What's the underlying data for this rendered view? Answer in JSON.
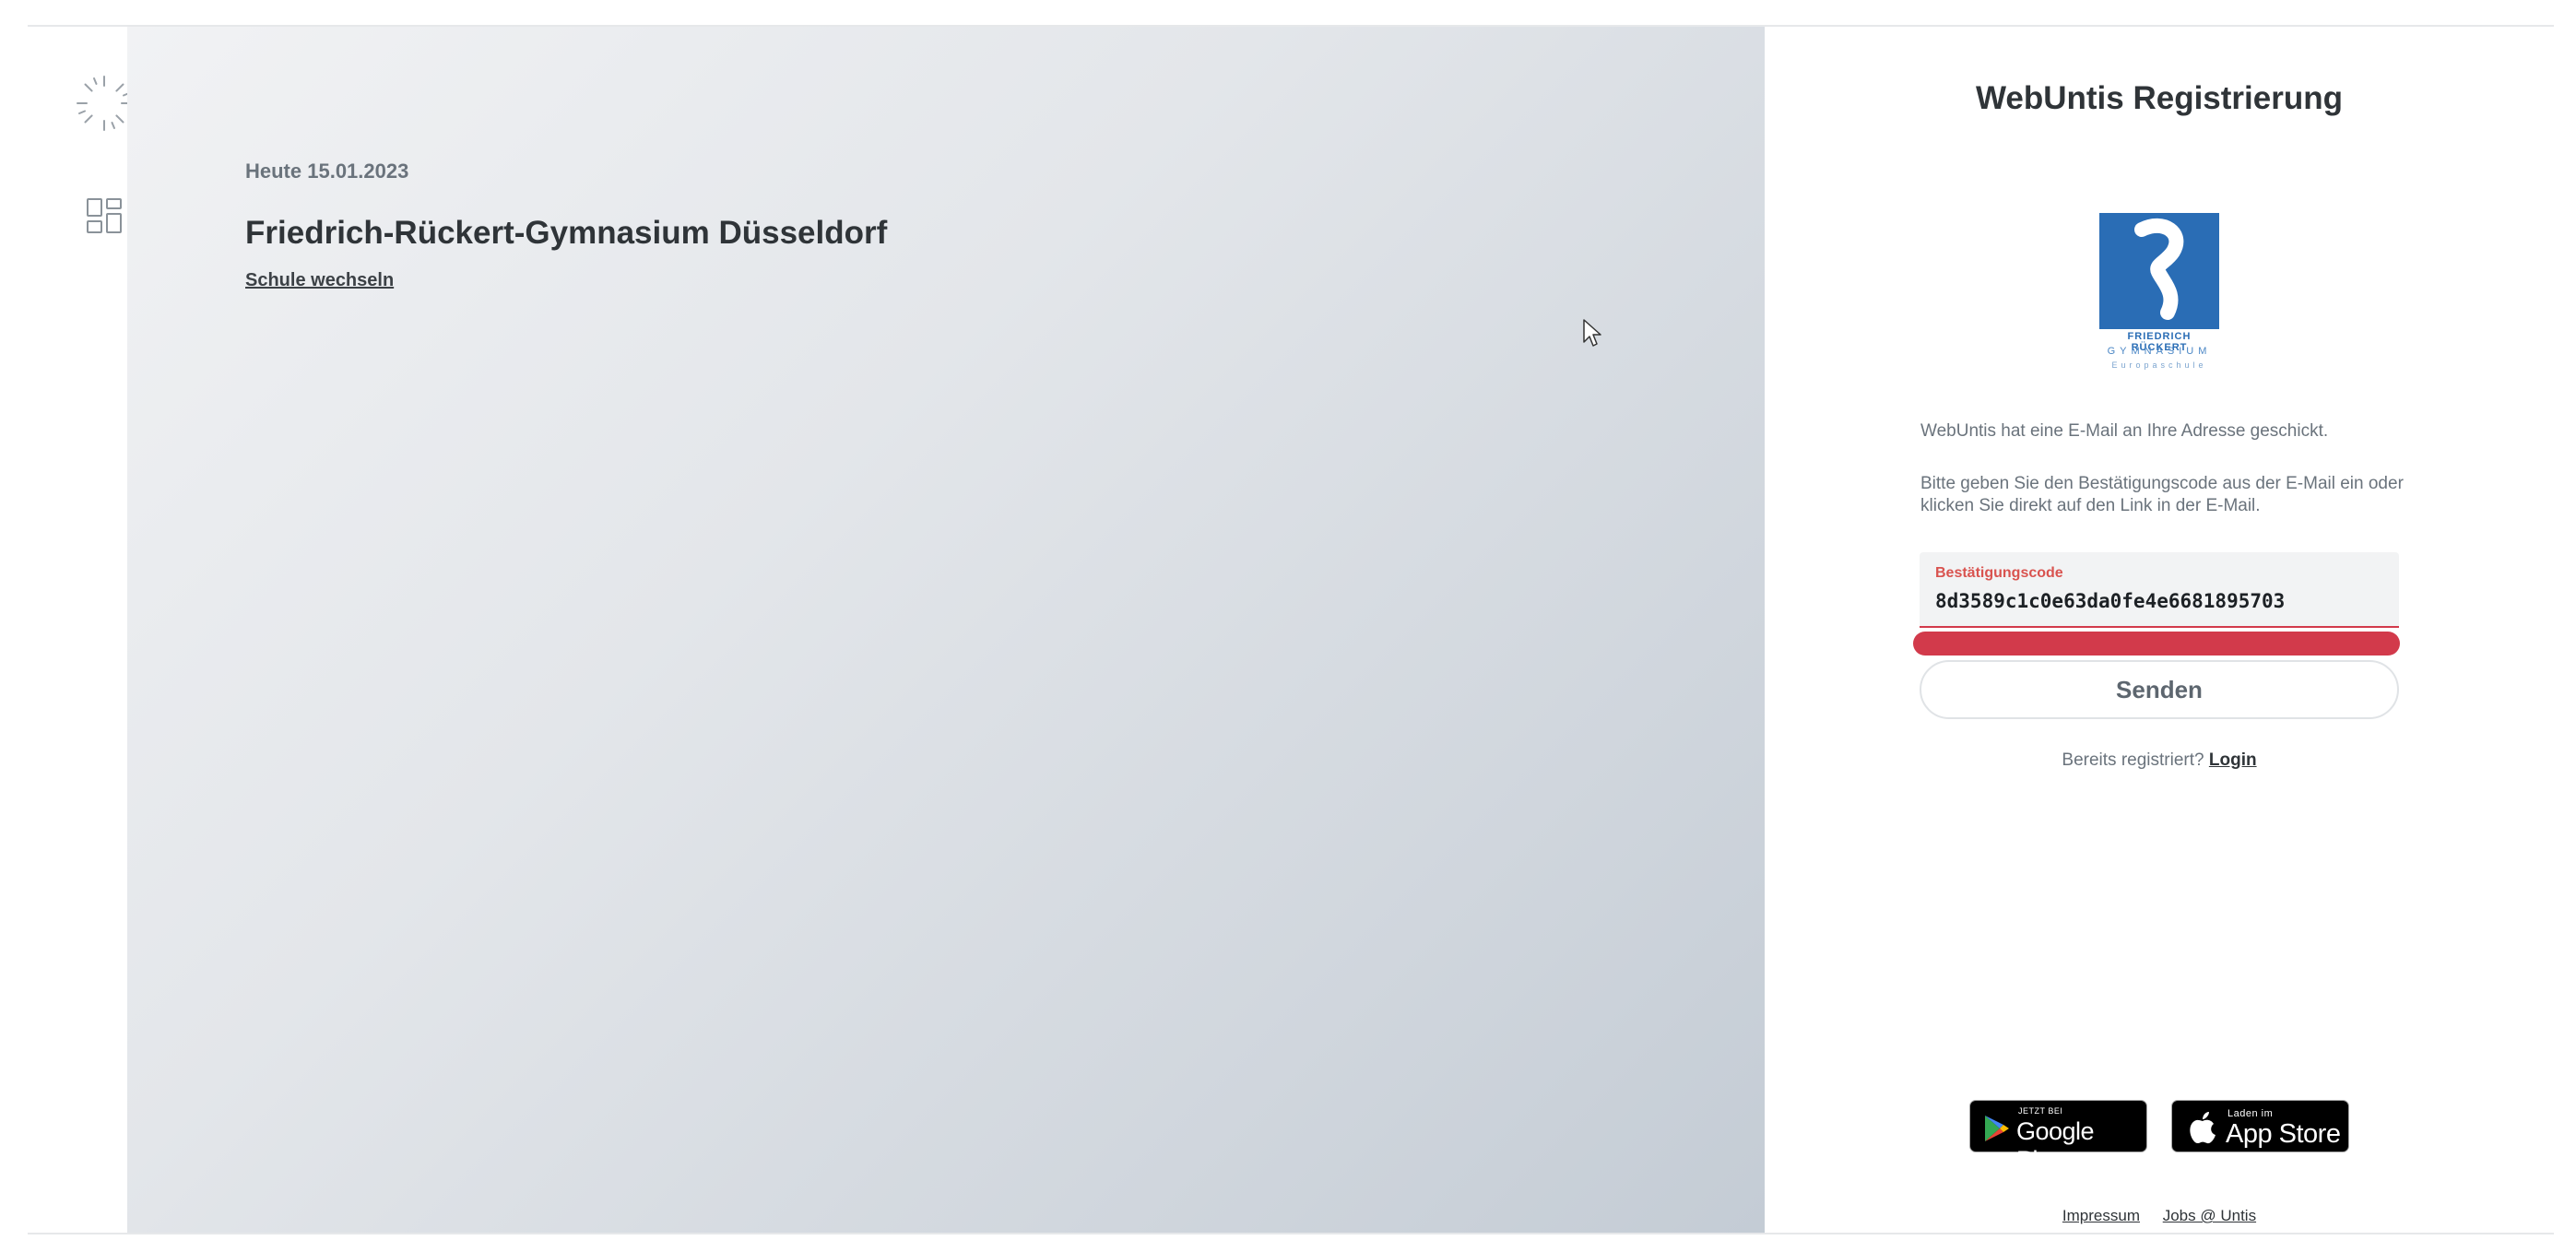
{
  "hero": {
    "date": "Heute 15.01.2023",
    "school_name": "Friedrich-Rückert-Gymnasium Düsseldorf",
    "switch_school": "Schule wechseln"
  },
  "panel": {
    "title": "WebUntis Registrierung",
    "logo": {
      "line1": "FRIEDRICH RÜCKERT",
      "line2": "GYMNASIUM",
      "line3": "Europaschule"
    },
    "message1": "WebUntis hat eine E-Mail an Ihre Adresse geschickt.",
    "message2": "Bitte geben Sie den Bestätigungscode aus der E-Mail ein oder klicken Sie direkt auf den Link in der E-Mail.",
    "code_field": {
      "label": "Bestätigungscode",
      "value": "8d3589c1c0e63da0fe4e6681895703"
    },
    "send_button": "Senden",
    "already_registered": "Bereits registriert?",
    "login_link": "Login",
    "google_play": {
      "small": "JETZT BEI",
      "big": "Google Play"
    },
    "app_store": {
      "small": "Laden im",
      "big": "App Store"
    },
    "footer": {
      "impressum": "Impressum",
      "jobs": "Jobs @ Untis"
    }
  },
  "colors": {
    "accent_error": "#d23a4b",
    "logo_blue": "#2a6db5",
    "text_dark": "#2f3438",
    "text_muted": "#6a737c"
  },
  "icons": [
    "loading-spinner-icon",
    "apps-grid-icon",
    "mouse-cursor-icon",
    "google-play-icon",
    "apple-icon"
  ]
}
